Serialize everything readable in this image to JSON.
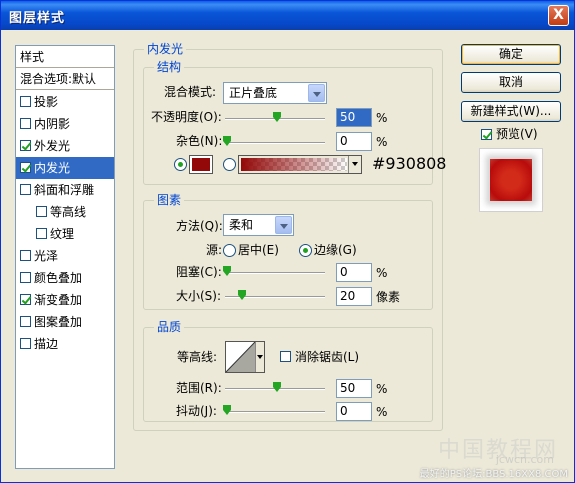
{
  "window": {
    "title": "图层样式",
    "close_glyph": "X"
  },
  "style_list": {
    "header": "样式",
    "blend_options": "混合选项:默认",
    "items": [
      {
        "label": "投影",
        "checked": false
      },
      {
        "label": "内阴影",
        "checked": false
      },
      {
        "label": "外发光",
        "checked": true
      },
      {
        "label": "内发光",
        "checked": true,
        "selected": true
      },
      {
        "label": "斜面和浮雕",
        "checked": false
      },
      {
        "label": "等高线",
        "checked": false,
        "indent": true
      },
      {
        "label": "纹理",
        "checked": false,
        "indent": true
      },
      {
        "label": "光泽",
        "checked": false
      },
      {
        "label": "颜色叠加",
        "checked": false
      },
      {
        "label": "渐变叠加",
        "checked": true
      },
      {
        "label": "图案叠加",
        "checked": false
      },
      {
        "label": "描边",
        "checked": false
      }
    ]
  },
  "panel": {
    "title": "内发光",
    "structure": {
      "title": "结构",
      "blend_mode_label": "混合模式:",
      "blend_mode_value": "正片叠底",
      "opacity_label": "不透明度(O):",
      "opacity_value": "50",
      "opacity_unit": "%",
      "noise_label": "杂色(N):",
      "noise_value": "0",
      "noise_unit": "%",
      "color_hex_text": "#930808",
      "color": "#930808"
    },
    "elements": {
      "title": "图素",
      "method_label": "方法(Q):",
      "method_value": "柔和",
      "source_label": "源:",
      "source_center": "居中(E)",
      "source_edge": "边缘(G)",
      "choke_label": "阻塞(C):",
      "choke_value": "0",
      "choke_unit": "%",
      "size_label": "大小(S):",
      "size_value": "20",
      "size_unit": "像素"
    },
    "quality": {
      "title": "品质",
      "contour_label": "等高线:",
      "antialias_label": "消除锯齿(L)",
      "range_label": "范围(R):",
      "range_value": "50",
      "range_unit": "%",
      "jitter_label": "抖动(J):",
      "jitter_value": "0",
      "jitter_unit": "%"
    }
  },
  "buttons": {
    "ok": "确定",
    "cancel": "取消",
    "new_style": "新建样式(W)...",
    "preview_label": "预览(V)"
  },
  "watermark": {
    "line1": "最好的PS论坛:BBS.16XX8.COM",
    "big": "中国教程网",
    "url": "jcwcn.com"
  }
}
